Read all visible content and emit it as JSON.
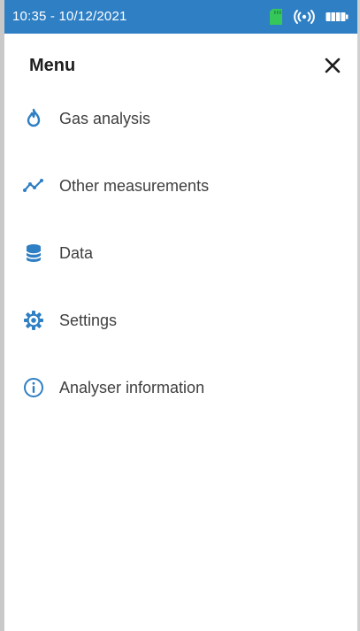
{
  "status_bar": {
    "datetime": "10:35 - 10/12/2021",
    "icons": [
      "sd-card-icon",
      "wireless-signal-icon",
      "battery-icon"
    ]
  },
  "menu": {
    "title": "Menu",
    "close_icon": "close-icon",
    "items": [
      {
        "label": "Gas analysis",
        "icon": "flame-icon"
      },
      {
        "label": "Other measurements",
        "icon": "trend-line-icon"
      },
      {
        "label": "Data",
        "icon": "database-icon"
      },
      {
        "label": "Settings",
        "icon": "gear-icon"
      },
      {
        "label": "Analyser information",
        "icon": "info-icon"
      }
    ]
  },
  "colors": {
    "status_bar": "#2f7fc4",
    "accent": "#2f7fc4",
    "sd_card": "#35c759",
    "text": "#3f3f3f",
    "title": "#1f1f1f",
    "background": "#ffffff"
  }
}
